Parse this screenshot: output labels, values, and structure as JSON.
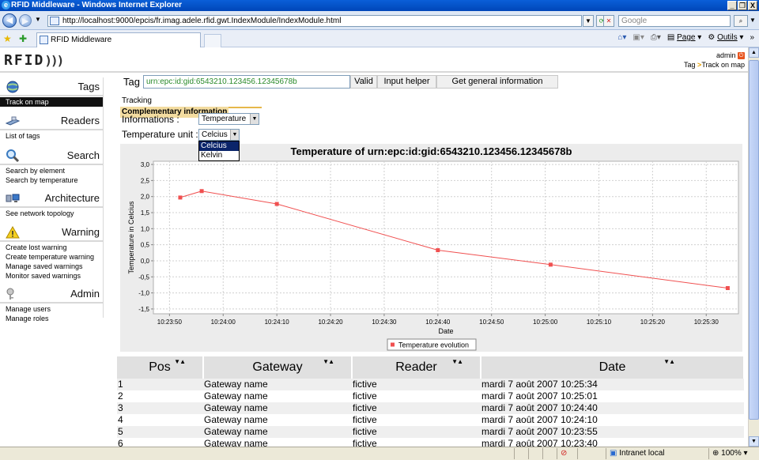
{
  "window": {
    "title": "RFID Middleware - Windows Internet Explorer",
    "minimize": "_",
    "restore": "❐",
    "close": "X"
  },
  "browser": {
    "url": "http://localhost:9000/epcis/fr.imag.adele.rfid.gwt.IndexModule/IndexModule.html",
    "search_placeholder": "Google",
    "tab_title": "RFID Middleware",
    "cmd_page": "Page",
    "cmd_tools": "Outils",
    "zoom": "100%",
    "zone": "Intranet local"
  },
  "app": {
    "logo": "RFID",
    "logo_waves": ")))",
    "user": "admin",
    "breadcrumb_root": "Tag",
    "breadcrumb_sep": ">",
    "breadcrumb_current": "Track on map"
  },
  "sidebar": {
    "sections": [
      {
        "title": "Tags",
        "icon": "globe-icon",
        "links": [
          "Track on map"
        ]
      },
      {
        "title": "Readers",
        "icon": "reader-icon",
        "links": [
          "List of tags"
        ]
      },
      {
        "title": "Search",
        "icon": "magnifier-icon",
        "links": [
          "Search by element",
          "Search by temperature"
        ]
      },
      {
        "title": "Architecture",
        "icon": "network-icon",
        "links": [
          "See network topology"
        ]
      },
      {
        "title": "Warning",
        "icon": "warning-icon",
        "links": [
          "Create lost warning",
          "Create temperature warning",
          "Manage saved warnings",
          "Monitor saved warnings"
        ]
      },
      {
        "title": "Admin",
        "icon": "keys-icon",
        "links": [
          "Manage users",
          "Manage roles"
        ]
      }
    ]
  },
  "tag_form": {
    "label": "Tag :",
    "value": "urn:epc:id:gid:6543210.123456.12345678b",
    "valid_button": "Valid",
    "helper_button": "Input helper",
    "info_button": "Get general information"
  },
  "subtabs": [
    "Tracking",
    "Complementary information"
  ],
  "informations": {
    "label": "Informations :",
    "value": "Temperature"
  },
  "temperature_unit": {
    "label": "Temperature unit :",
    "value": "Celcius",
    "options": [
      "Celcius",
      "Kelvin"
    ]
  },
  "chart_data": {
    "type": "line",
    "title": "Temperature of urn:epc:id:gid:6543210.123456.12345678b",
    "xlabel": "Date",
    "ylabel": "Temperature in Celcius",
    "x_ticks": [
      "10:23:50",
      "10:24:00",
      "10:24:10",
      "10:24:20",
      "10:24:30",
      "10:24:40",
      "10:24:50",
      "10:25:00",
      "10:25:10",
      "10:25:20",
      "10:25:30"
    ],
    "y_ticks": [
      "3,0",
      "2,5",
      "2,0",
      "1,5",
      "1,0",
      "0,5",
      "0,0",
      "-0,5",
      "-1,0",
      "-1,5"
    ],
    "xlim": [
      "10:23:47",
      "10:25:36"
    ],
    "ylim": [
      -1.65,
      3.1
    ],
    "grid": true,
    "legend_position": "bottom-center",
    "color": "#f05050",
    "series": [
      {
        "name": "Temperature evolution",
        "x": [
          "10:23:52",
          "10:23:56",
          "10:24:10",
          "10:24:40",
          "10:25:01",
          "10:25:34"
        ],
        "y": [
          1.97,
          2.17,
          1.77,
          0.33,
          -0.12,
          -0.85
        ]
      }
    ]
  },
  "table": {
    "columns": [
      "Pos",
      "Gateway",
      "Reader",
      "Date"
    ],
    "rows": [
      [
        "1",
        "Gateway name",
        "fictive",
        "mardi 7 août 2007 10:25:34"
      ],
      [
        "2",
        "Gateway name",
        "fictive",
        "mardi 7 août 2007 10:25:01"
      ],
      [
        "3",
        "Gateway name",
        "fictive",
        "mardi 7 août 2007 10:24:40"
      ],
      [
        "4",
        "Gateway name",
        "fictive",
        "mardi 7 août 2007 10:24:10"
      ],
      [
        "5",
        "Gateway name",
        "fictive",
        "mardi 7 août 2007 10:23:55"
      ],
      [
        "6",
        "Gateway name",
        "fictive",
        "mardi 7 août 2007 10:23:40"
      ]
    ]
  }
}
